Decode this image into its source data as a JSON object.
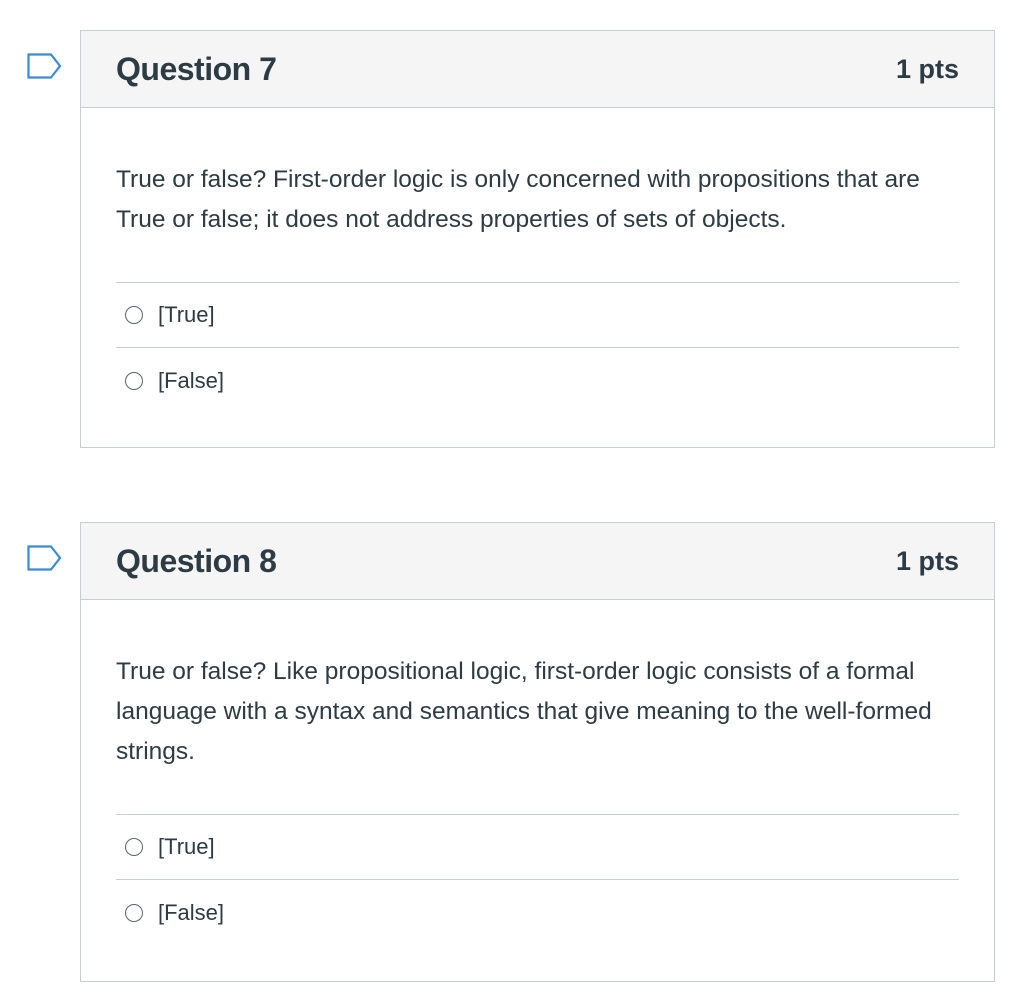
{
  "questions": [
    {
      "title": "Question 7",
      "points": "1 pts",
      "text": "True or false? First-order logic is only concerned with propositions that are True or false; it does not address properties of sets of objects.",
      "answers": [
        "[True]",
        "[False]"
      ]
    },
    {
      "title": "Question 8",
      "points": "1 pts",
      "text": "True or false? Like propositional logic, first-order logic consists of a formal language with a syntax and semantics that give meaning to the well-formed strings.",
      "answers": [
        "[True]",
        "[False]"
      ]
    }
  ],
  "colors": {
    "header_bg": "#f5f5f5",
    "border": "#c7cdd1",
    "text": "#2d3b45",
    "flag_stroke": "#3b8ad8"
  }
}
